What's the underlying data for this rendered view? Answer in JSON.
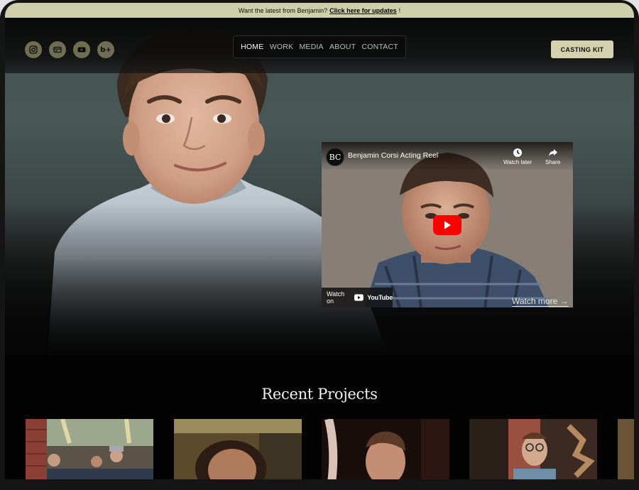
{
  "announcement": {
    "text": "Want the latest from Benjamin?",
    "link": "Click here for updates",
    "suffix": "!"
  },
  "socials": [
    {
      "icon": "instagram-icon"
    },
    {
      "icon": "card-icon"
    },
    {
      "icon": "youtube-icon"
    },
    {
      "icon": "behance-icon",
      "glyph": "b+"
    }
  ],
  "nav": {
    "items": [
      "HOME",
      "WORK",
      "MEDIA",
      "ABOUT",
      "CONTACT"
    ],
    "active": "HOME"
  },
  "casting_kit": "CASTING KIT",
  "video": {
    "channel_initials": "BC",
    "title": "Benjamin Corsi Acting Reel",
    "watch_later": "Watch later",
    "share": "Share",
    "watch_on": "Watch on",
    "youtube": "YouTube"
  },
  "watch_more": "Watch more →",
  "recent": {
    "title": "Recent Projects"
  },
  "colors": {
    "accent": "#d3d1ae",
    "announce_bg": "#d0cfac",
    "youtube_red": "#ff0000"
  }
}
